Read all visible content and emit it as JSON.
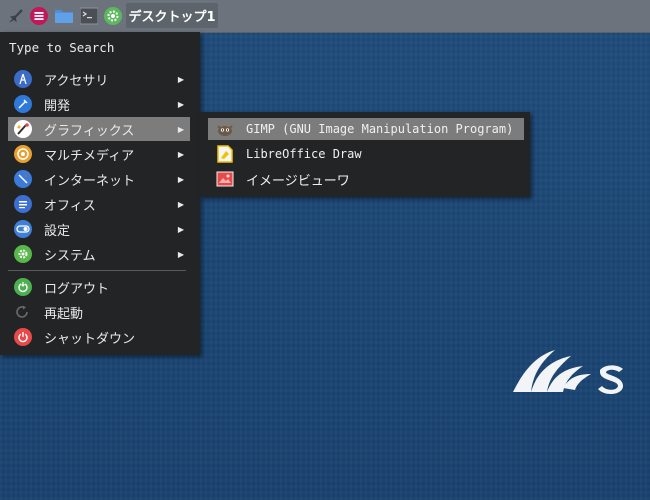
{
  "panel": {
    "workspace_label": "デスクトップ1",
    "icons": [
      "rocket-icon",
      "menu-icon",
      "folder-icon",
      "terminal-icon",
      "settings-icon"
    ]
  },
  "menu": {
    "search_placeholder": "Type to Search",
    "categories": [
      {
        "label": "アクセサリ",
        "icon": "accessories-icon",
        "color": "#3a6cc8"
      },
      {
        "label": "開発",
        "icon": "development-icon",
        "color": "#2f7ad9"
      },
      {
        "label": "グラフィックス",
        "icon": "graphics-icon",
        "color": "#ffffff"
      },
      {
        "label": "マルチメディア",
        "icon": "multimedia-icon",
        "color": "#e8a030"
      },
      {
        "label": "インターネット",
        "icon": "internet-icon",
        "color": "#3b7ad8"
      },
      {
        "label": "オフィス",
        "icon": "office-icon",
        "color": "#3b6fd1"
      },
      {
        "label": "設定",
        "icon": "settings-icon",
        "color": "#3e80d8"
      },
      {
        "label": "システム",
        "icon": "system-icon",
        "color": "#59b84a"
      }
    ],
    "actions": [
      {
        "label": "ログアウト",
        "icon": "logout-icon",
        "color": "#4caf50"
      },
      {
        "label": "再起動",
        "icon": "restart-icon",
        "color": "#666666"
      },
      {
        "label": "シャットダウン",
        "icon": "shutdown-icon",
        "color": "#e84a4a"
      }
    ]
  },
  "submenu": {
    "items": [
      {
        "label": "GIMP (GNU Image Manipulation Program)",
        "icon": "gimp-icon"
      },
      {
        "label": "LibreOffice Draw",
        "icon": "libreoffice-draw-icon"
      },
      {
        "label": "イメージビューワ",
        "icon": "image-viewer-icon"
      }
    ]
  },
  "colors": {
    "panel_bg": "#6c737c",
    "menu_bg": "#232426",
    "highlight": "#7c7c7c",
    "desktop_bg": "#1d4a78"
  }
}
